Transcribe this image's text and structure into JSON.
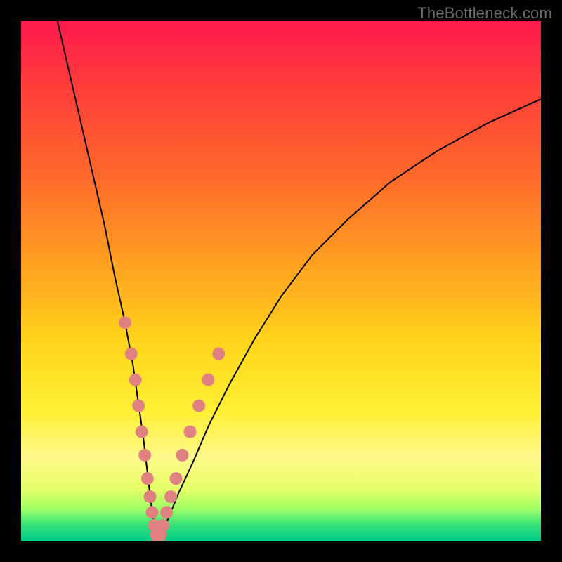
{
  "watermark": "TheBottleneck.com",
  "chart_data": {
    "type": "line",
    "title": "",
    "xlabel": "",
    "ylabel": "",
    "xlim": [
      0,
      100
    ],
    "ylim": [
      0,
      100
    ],
    "curve_left": {
      "name": "left-branch",
      "x": [
        7,
        10,
        13,
        16,
        18,
        20,
        21.5,
        22.5,
        23.5,
        24.2,
        24.8,
        25.2,
        25.6,
        25.9,
        26.1,
        26.2
      ],
      "y": [
        100,
        87,
        74,
        61,
        51,
        42,
        34,
        27,
        20,
        14,
        9,
        5.5,
        3,
        1.5,
        0.6,
        0.2
      ]
    },
    "curve_right": {
      "name": "right-branch",
      "x": [
        26.2,
        26.6,
        27.4,
        28.6,
        30.2,
        33,
        36,
        40,
        45,
        50,
        56,
        63,
        71,
        80,
        90,
        100
      ],
      "y": [
        0.2,
        0.8,
        2.2,
        5,
        9,
        15,
        22,
        30,
        39,
        47,
        55,
        62,
        69,
        75,
        80.5,
        85
      ]
    },
    "markers": {
      "name": "highlight-dots",
      "color": "#e08080",
      "points": [
        {
          "x": 20.0,
          "y": 42.0
        },
        {
          "x": 21.2,
          "y": 36.0
        },
        {
          "x": 22.0,
          "y": 31.0
        },
        {
          "x": 22.6,
          "y": 26.0
        },
        {
          "x": 23.2,
          "y": 21.0
        },
        {
          "x": 23.8,
          "y": 16.5
        },
        {
          "x": 24.3,
          "y": 12.0
        },
        {
          "x": 24.8,
          "y": 8.5
        },
        {
          "x": 25.2,
          "y": 5.5
        },
        {
          "x": 25.6,
          "y": 3.0
        },
        {
          "x": 26.0,
          "y": 1.2
        },
        {
          "x": 26.3,
          "y": 0.4
        },
        {
          "x": 26.8,
          "y": 1.2
        },
        {
          "x": 27.3,
          "y": 3.0
        },
        {
          "x": 28.0,
          "y": 5.5
        },
        {
          "x": 28.8,
          "y": 8.5
        },
        {
          "x": 29.8,
          "y": 12.0
        },
        {
          "x": 31.0,
          "y": 16.5
        },
        {
          "x": 32.5,
          "y": 21.0
        },
        {
          "x": 34.2,
          "y": 26.0
        },
        {
          "x": 36.0,
          "y": 31.0
        },
        {
          "x": 38.0,
          "y": 36.0
        }
      ]
    },
    "gradient_stops": [
      {
        "pos": 0.0,
        "color": "#ff1a4d"
      },
      {
        "pos": 0.3,
        "color": "#ff6a2a"
      },
      {
        "pos": 0.62,
        "color": "#ffd61a"
      },
      {
        "pos": 0.9,
        "color": "#e6ff66"
      },
      {
        "pos": 1.0,
        "color": "#00cc88"
      }
    ]
  }
}
